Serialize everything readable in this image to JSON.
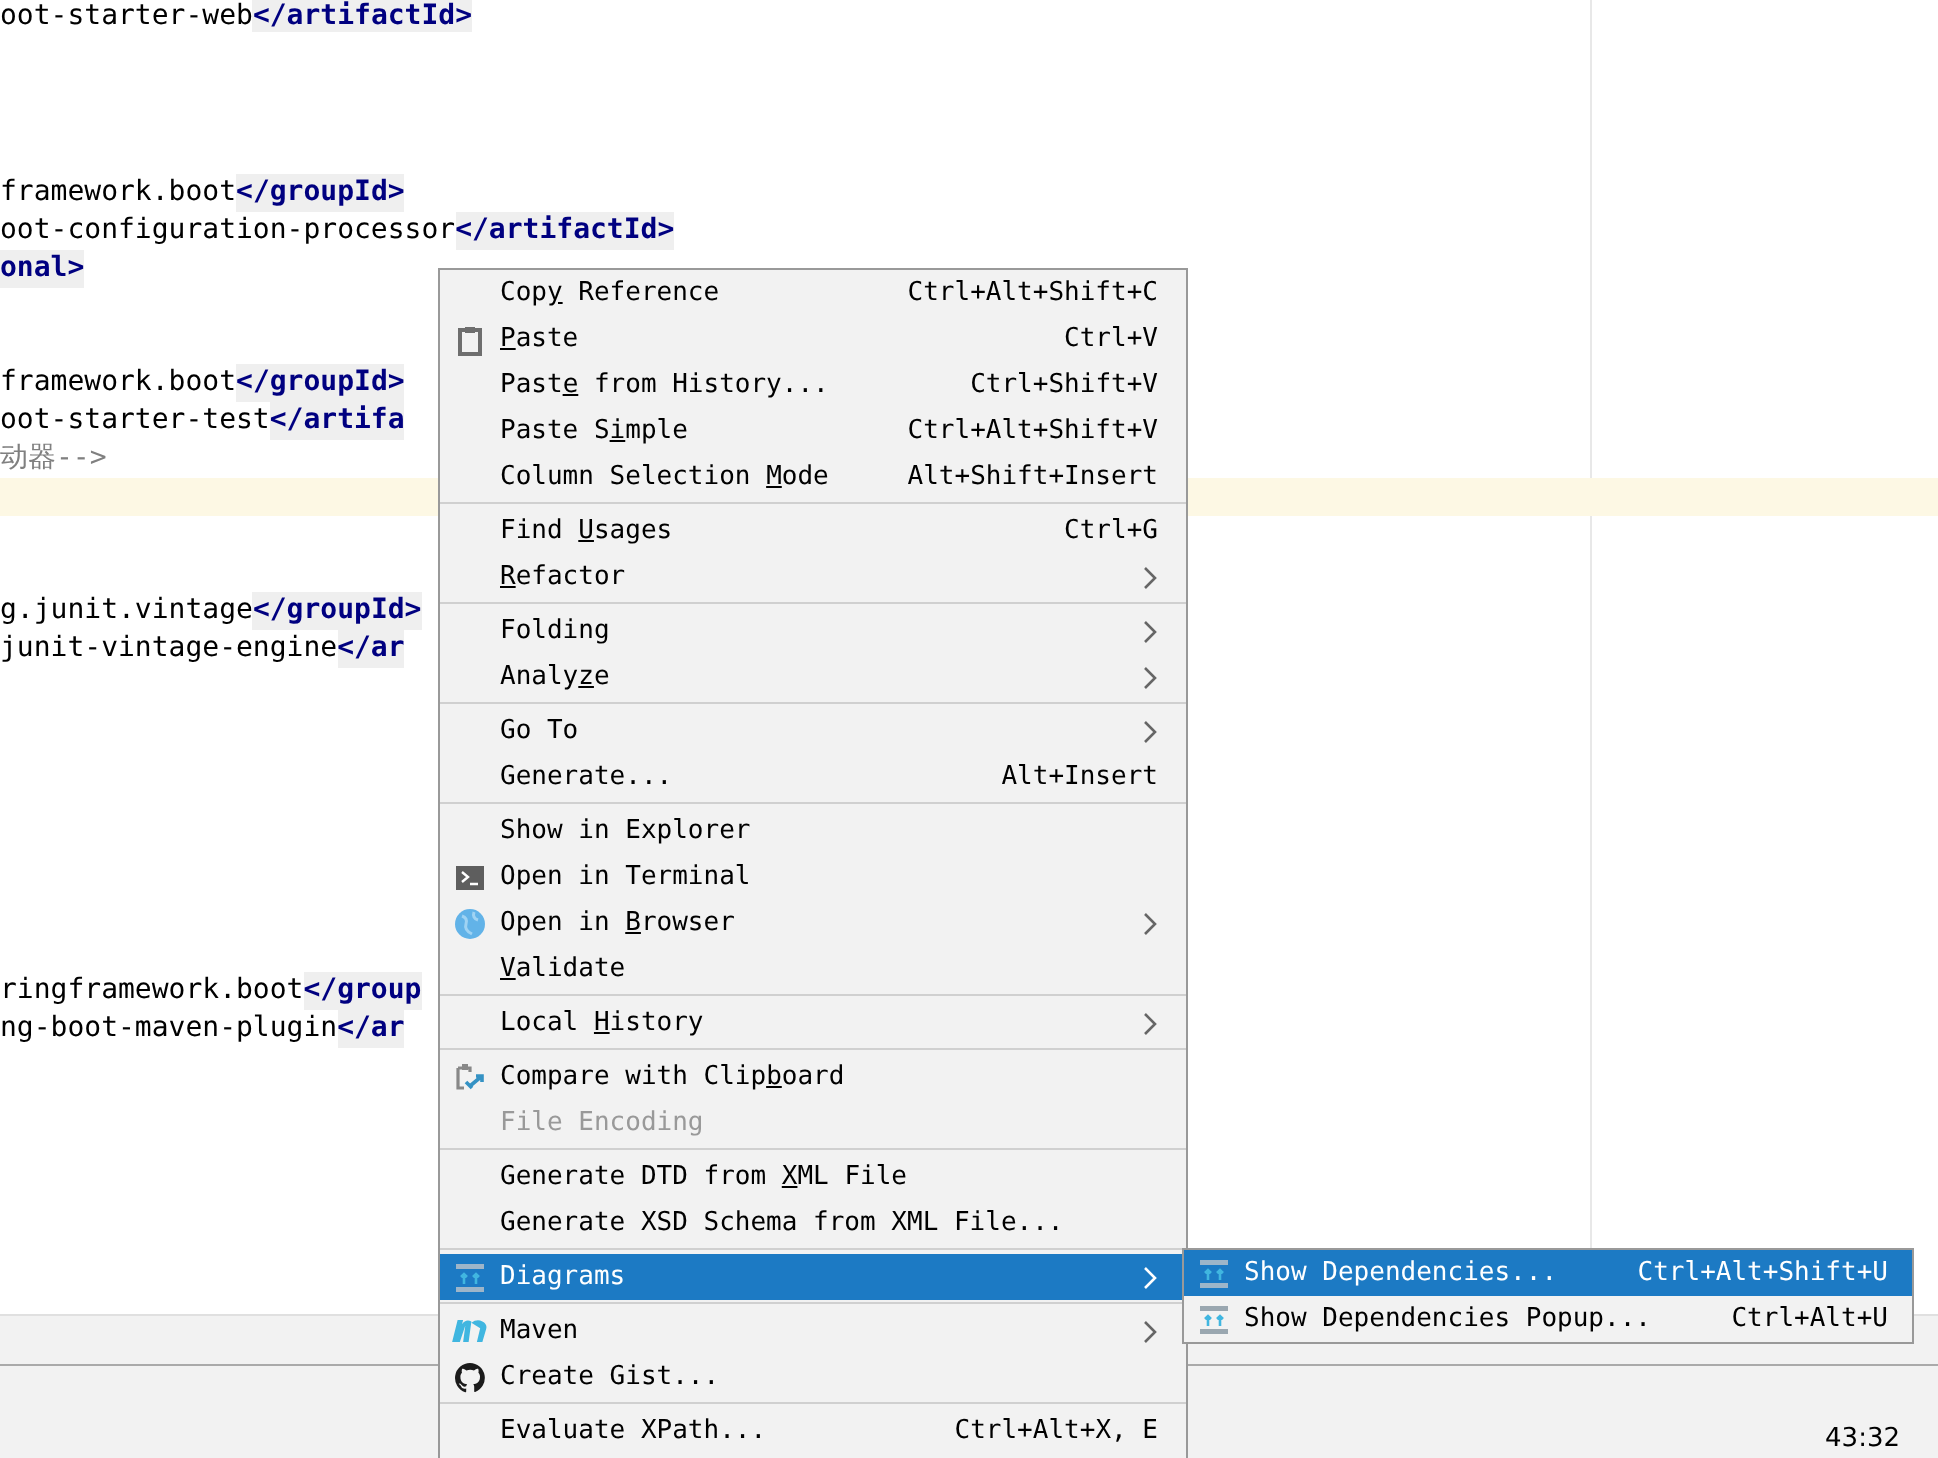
{
  "editor": {
    "lines": [
      {
        "segments": [
          {
            "kind": "text",
            "text": "oot-starter-web"
          },
          {
            "kind": "tag",
            "text": "</artifactId>"
          }
        ]
      },
      {
        "segments": [
          {
            "kind": "text",
            "text": "framework.boot"
          },
          {
            "kind": "tag",
            "text": "</groupId>"
          }
        ]
      },
      {
        "segments": [
          {
            "kind": "text",
            "text": "oot-configuration-processor"
          },
          {
            "kind": "tag",
            "text": "</artifactId>"
          }
        ]
      },
      {
        "segments": [
          {
            "kind": "tag",
            "text": "onal>"
          }
        ]
      },
      {
        "segments": [
          {
            "kind": "text",
            "text": "framework.boot"
          },
          {
            "kind": "tag",
            "text": "</groupId>"
          }
        ]
      },
      {
        "segments": [
          {
            "kind": "text",
            "text": "oot-starter-test"
          },
          {
            "kind": "tag",
            "text": "</artifa"
          }
        ]
      },
      {
        "segments": [
          {
            "kind": "comment",
            "text": "动器-->"
          }
        ]
      },
      {
        "segments": [
          {
            "kind": "text",
            "text": "g.junit.vintage"
          },
          {
            "kind": "tag",
            "text": "</groupId>"
          }
        ]
      },
      {
        "segments": [
          {
            "kind": "text",
            "text": "junit-vintage-engine"
          },
          {
            "kind": "tag",
            "text": "</ar"
          }
        ]
      },
      {
        "segments": [
          {
            "kind": "text",
            "text": "ringframework.boot"
          },
          {
            "kind": "tag",
            "text": "</group"
          }
        ]
      },
      {
        "segments": [
          {
            "kind": "text",
            "text": "ng-boot-maven-plugin"
          },
          {
            "kind": "tag",
            "text": "</ar"
          }
        ]
      }
    ]
  },
  "status_bar": {
    "position": "43:32"
  },
  "context_menu": {
    "groups": [
      [
        {
          "label": [
            {
              "text": "Cop",
              "underlined": false
            },
            {
              "text": "y",
              "underlined": true
            },
            {
              "text": " Reference",
              "underlined": false
            }
          ],
          "shortcut": "Ctrl+Alt+Shift+C",
          "submenu": false,
          "disabled": false,
          "selected": false
        },
        {
          "label": [
            {
              "text": "P",
              "underlined": true
            },
            {
              "text": "aste",
              "underlined": false
            }
          ],
          "shortcut": "Ctrl+V",
          "submenu": false,
          "disabled": false,
          "selected": false
        },
        {
          "label": [
            {
              "text": "Past",
              "underlined": false
            },
            {
              "text": "e",
              "underlined": true
            },
            {
              "text": " from History...",
              "underlined": false
            }
          ],
          "shortcut": "Ctrl+Shift+V",
          "submenu": false,
          "disabled": false,
          "selected": false
        },
        {
          "label": [
            {
              "text": "Paste S",
              "underlined": false
            },
            {
              "text": "i",
              "underlined": true
            },
            {
              "text": "mple",
              "underlined": false
            }
          ],
          "shortcut": "Ctrl+Alt+Shift+V",
          "submenu": false,
          "disabled": false,
          "selected": false
        },
        {
          "label": [
            {
              "text": "Column Selection ",
              "underlined": false
            },
            {
              "text": "M",
              "underlined": true
            },
            {
              "text": "ode",
              "underlined": false
            }
          ],
          "shortcut": "Alt+Shift+Insert",
          "submenu": false,
          "disabled": false,
          "selected": false
        }
      ],
      [
        {
          "label": [
            {
              "text": "Find ",
              "underlined": false
            },
            {
              "text": "U",
              "underlined": true
            },
            {
              "text": "sages",
              "underlined": false
            }
          ],
          "shortcut": "Ctrl+G",
          "submenu": false,
          "disabled": false,
          "selected": false
        },
        {
          "label": [
            {
              "text": "R",
              "underlined": true
            },
            {
              "text": "efactor",
              "underlined": false
            }
          ],
          "submenu": true,
          "disabled": false,
          "selected": false
        }
      ],
      [
        {
          "label": [
            {
              "text": "Folding",
              "underlined": false
            }
          ],
          "submenu": true,
          "disabled": false,
          "selected": false
        },
        {
          "label": [
            {
              "text": "Analy",
              "underlined": false
            },
            {
              "text": "z",
              "underlined": true
            },
            {
              "text": "e",
              "underlined": false
            }
          ],
          "submenu": true,
          "disabled": false,
          "selected": false
        }
      ],
      [
        {
          "label": [
            {
              "text": "Go To",
              "underlined": false
            }
          ],
          "submenu": true,
          "disabled": false,
          "selected": false
        },
        {
          "label": [
            {
              "text": "Generate...",
              "underlined": false
            }
          ],
          "shortcut": "Alt+Insert",
          "submenu": false,
          "disabled": false,
          "selected": false
        }
      ],
      [
        {
          "label": [
            {
              "text": "Show in Explorer",
              "underlined": false
            }
          ],
          "submenu": false,
          "disabled": false,
          "selected": false
        },
        {
          "label": [
            {
              "text": "Open in Terminal",
              "underlined": false
            }
          ],
          "submenu": false,
          "disabled": false,
          "selected": false
        },
        {
          "label": [
            {
              "text": "Open in ",
              "underlined": false
            },
            {
              "text": "B",
              "underlined": true
            },
            {
              "text": "rowser",
              "underlined": false
            }
          ],
          "submenu": true,
          "disabled": false,
          "selected": false
        },
        {
          "label": [
            {
              "text": "V",
              "underlined": true
            },
            {
              "text": "alidate",
              "underlined": false
            }
          ],
          "submenu": false,
          "disabled": false,
          "selected": false
        }
      ],
      [
        {
          "label": [
            {
              "text": "Local ",
              "underlined": false
            },
            {
              "text": "H",
              "underlined": true
            },
            {
              "text": "istory",
              "underlined": false
            }
          ],
          "submenu": true,
          "disabled": false,
          "selected": false
        }
      ],
      [
        {
          "label": [
            {
              "text": "Compare with Clip",
              "underlined": false
            },
            {
              "text": "b",
              "underlined": true
            },
            {
              "text": "oard",
              "underlined": false
            }
          ],
          "submenu": false,
          "disabled": false,
          "selected": false
        },
        {
          "label": [
            {
              "text": "File Encoding",
              "underlined": false
            }
          ],
          "submenu": false,
          "disabled": true,
          "selected": false
        }
      ],
      [
        {
          "label": [
            {
              "text": "Generate DTD from ",
              "underlined": false
            },
            {
              "text": "X",
              "underlined": true
            },
            {
              "text": "ML File",
              "underlined": false
            }
          ],
          "submenu": false,
          "disabled": false,
          "selected": false
        },
        {
          "label": [
            {
              "text": "Generate XSD Schema from XML File...",
              "underlined": false
            }
          ],
          "submenu": false,
          "disabled": false,
          "selected": false
        }
      ],
      [
        {
          "label": [
            {
              "text": "Diagrams",
              "underlined": false
            }
          ],
          "submenu": true,
          "disabled": false,
          "selected": true
        }
      ],
      [
        {
          "label": [
            {
              "text": "Maven",
              "underlined": false
            }
          ],
          "submenu": true,
          "disabled": false,
          "selected": false
        },
        {
          "label": [
            {
              "text": "Create Gist...",
              "underlined": false
            }
          ],
          "submenu": false,
          "disabled": false,
          "selected": false
        }
      ],
      [
        {
          "label": [
            {
              "text": "Evaluate XPath...",
              "underlined": false
            }
          ],
          "shortcut": "Ctrl+Alt+X, E",
          "submenu": false,
          "disabled": false,
          "selected": false
        }
      ]
    ]
  },
  "submenu": {
    "items": [
      {
        "label": "Show Dependencies...",
        "shortcut": "Ctrl+Alt+Shift+U",
        "selected": true
      },
      {
        "label": "Show Dependencies Popup...",
        "shortcut": "Ctrl+Alt+U",
        "selected": false
      }
    ]
  }
}
